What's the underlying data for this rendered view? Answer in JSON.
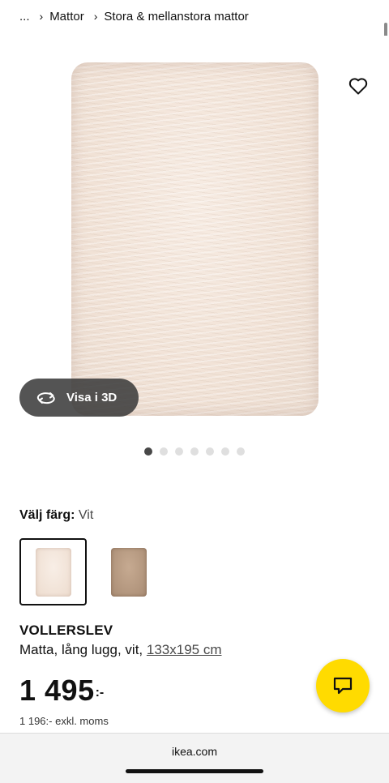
{
  "breadcrumb": {
    "items": [
      "...",
      "Mattor",
      "Stora & mellanstora mattor"
    ],
    "separator": "›"
  },
  "gallery": {
    "favorite_icon": "heart-outline-icon",
    "view_3d_label": "Visa i 3D",
    "view_3d_icon": "rotate-3d-icon",
    "image_count": 7,
    "active_image_index": 0
  },
  "color_selector": {
    "label": "Välj färg:",
    "selected_value": "Vit",
    "options": [
      {
        "name": "Vit",
        "color": "#f3e6dc",
        "selected": true
      },
      {
        "name": "Beige",
        "color": "#b79b83",
        "selected": false
      }
    ]
  },
  "product": {
    "name": "VOLLERSLEV",
    "description": "Matta, lång lugg, vit,",
    "size": "133x195 cm",
    "price": "1 495",
    "price_suffix": ":-",
    "price_excl_vat": "1 196:- exkl. moms"
  },
  "chat": {
    "icon": "chat-bubble-icon",
    "color": "#ffdb00"
  },
  "browser": {
    "domain": "ikea.com"
  }
}
